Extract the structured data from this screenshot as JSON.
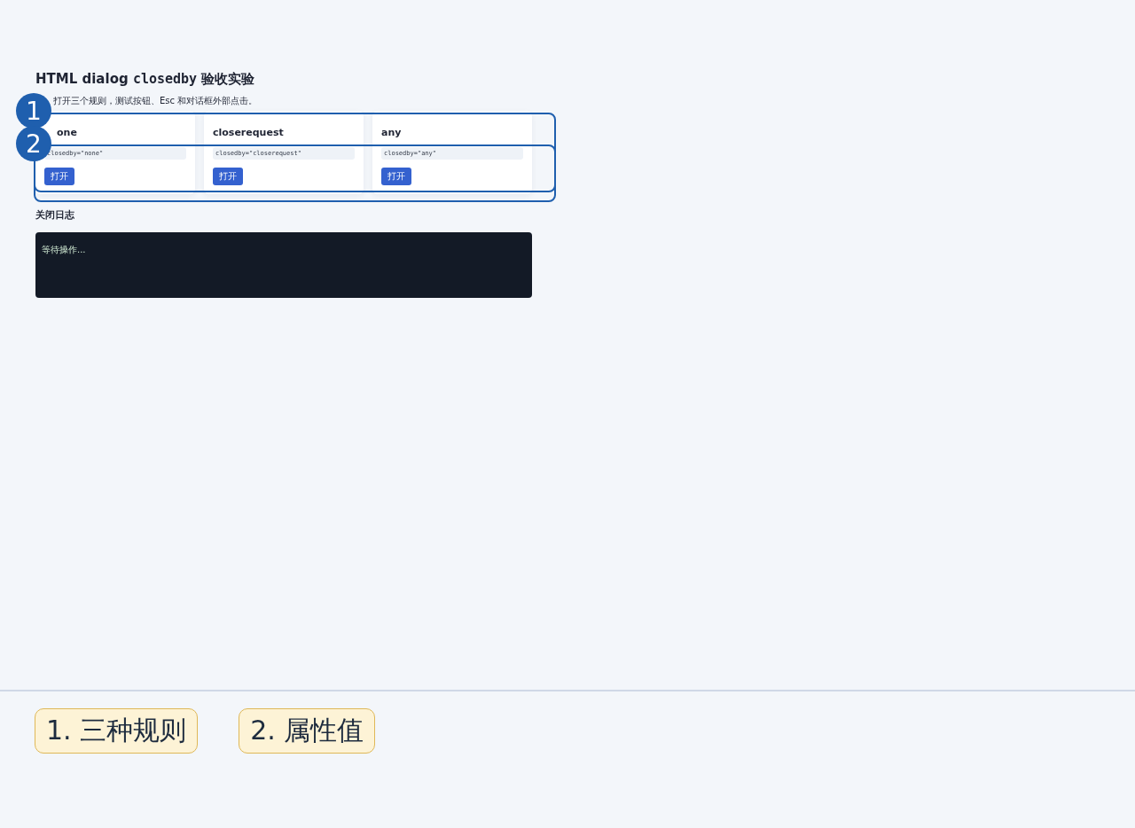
{
  "page": {
    "title": [
      {
        "kind": "text",
        "text": "HTML dialog "
      },
      {
        "kind": "code",
        "text": "closedby"
      },
      {
        "kind": "text",
        "text": " 验收实验"
      }
    ],
    "subtitle": "打开三个规则，测试按钮、Esc 和对话框外部点击。"
  },
  "cards": [
    {
      "title": "one",
      "code": "closedby=\"none\"",
      "button": "打开"
    },
    {
      "title": "closerequest",
      "code": "closedby=\"closerequest\"",
      "button": "打开"
    },
    {
      "title": "any",
      "code": "closedby=\"any\"",
      "button": "打开"
    }
  ],
  "log": {
    "heading": "关闭日志",
    "text": "等待操作..."
  },
  "annotations": [
    {
      "marker": "1",
      "legend": "1. 三种规则"
    },
    {
      "marker": "2",
      "legend": "2. 属性值"
    }
  ]
}
